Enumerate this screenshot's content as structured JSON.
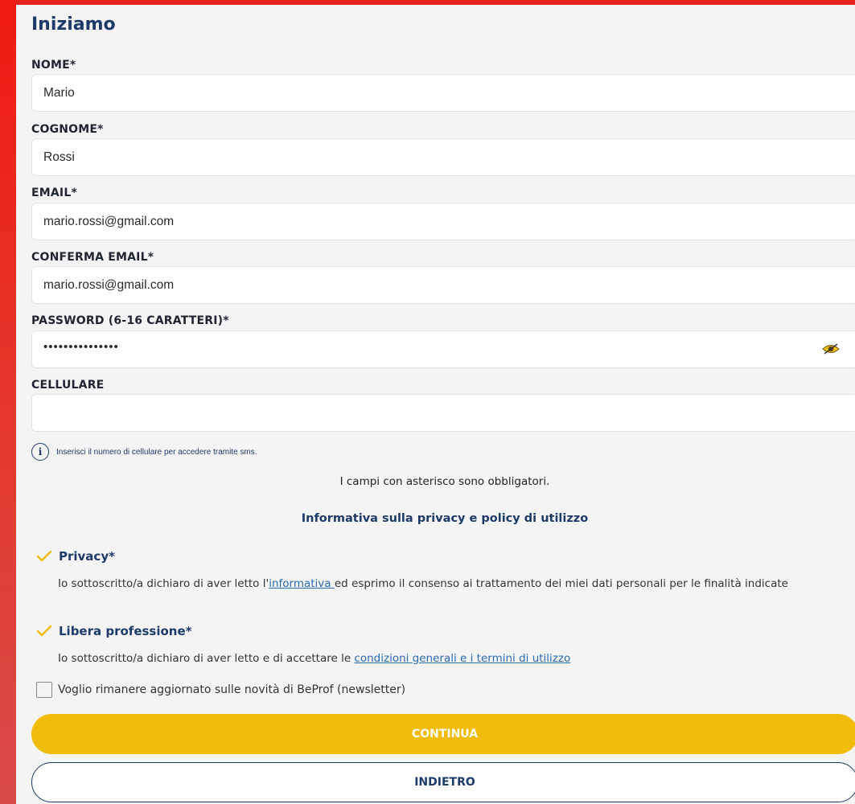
{
  "page": {
    "title": "Iniziamo"
  },
  "fields": [
    {
      "label": "NOME*",
      "value": "Mario"
    },
    {
      "label": "COGNOME*",
      "value": "Rossi"
    },
    {
      "label": "EMAIL*",
      "value": "mario.rossi@gmail.com"
    },
    {
      "label": "CONFERMA EMAIL*",
      "value": "mario.rossi@gmail.com"
    },
    {
      "label": "PASSWORD (6-16 CARATTERI)*",
      "value": "•••••••••••••••"
    },
    {
      "label": "CELLULARE",
      "value": ""
    }
  ],
  "info": {
    "text": "Inserisci il numero di cellulare per accedere tramite sms."
  },
  "required_note": "I campi con asterisco sono obbligatori.",
  "privacy_heading": "Informativa sulla privacy e policy di utilizzo",
  "privacy": {
    "title": "Privacy*",
    "checked": true,
    "text_before": "Io sottoscritto/a dichiaro di aver letto l'",
    "link": "informativa ",
    "text_after": "ed esprimo il consenso ai trattamento dei miei dati personali per le finalità indicate"
  },
  "libera": {
    "title": "Libera professione*",
    "checked": true,
    "text_before": "Io sottoscritto/a dichiaro di aver letto e di accettare le ",
    "link": "condizioni generali e i termini di utilizzo"
  },
  "newsletter": {
    "label": "Voglio rimanere aggiornato sulle novità di BeProf (newsletter)",
    "checked": false
  },
  "buttons": {
    "continue": "CONTINUA",
    "back": "INDIETRO"
  },
  "colors": {
    "accent": "#f2bc0d",
    "navy": "#1e3a68",
    "link": "#2a6ab0",
    "frame": "#e8201c"
  },
  "icons": {
    "password_toggle": "eye-icon",
    "info": "info-icon",
    "check": "checkmark-icon"
  }
}
